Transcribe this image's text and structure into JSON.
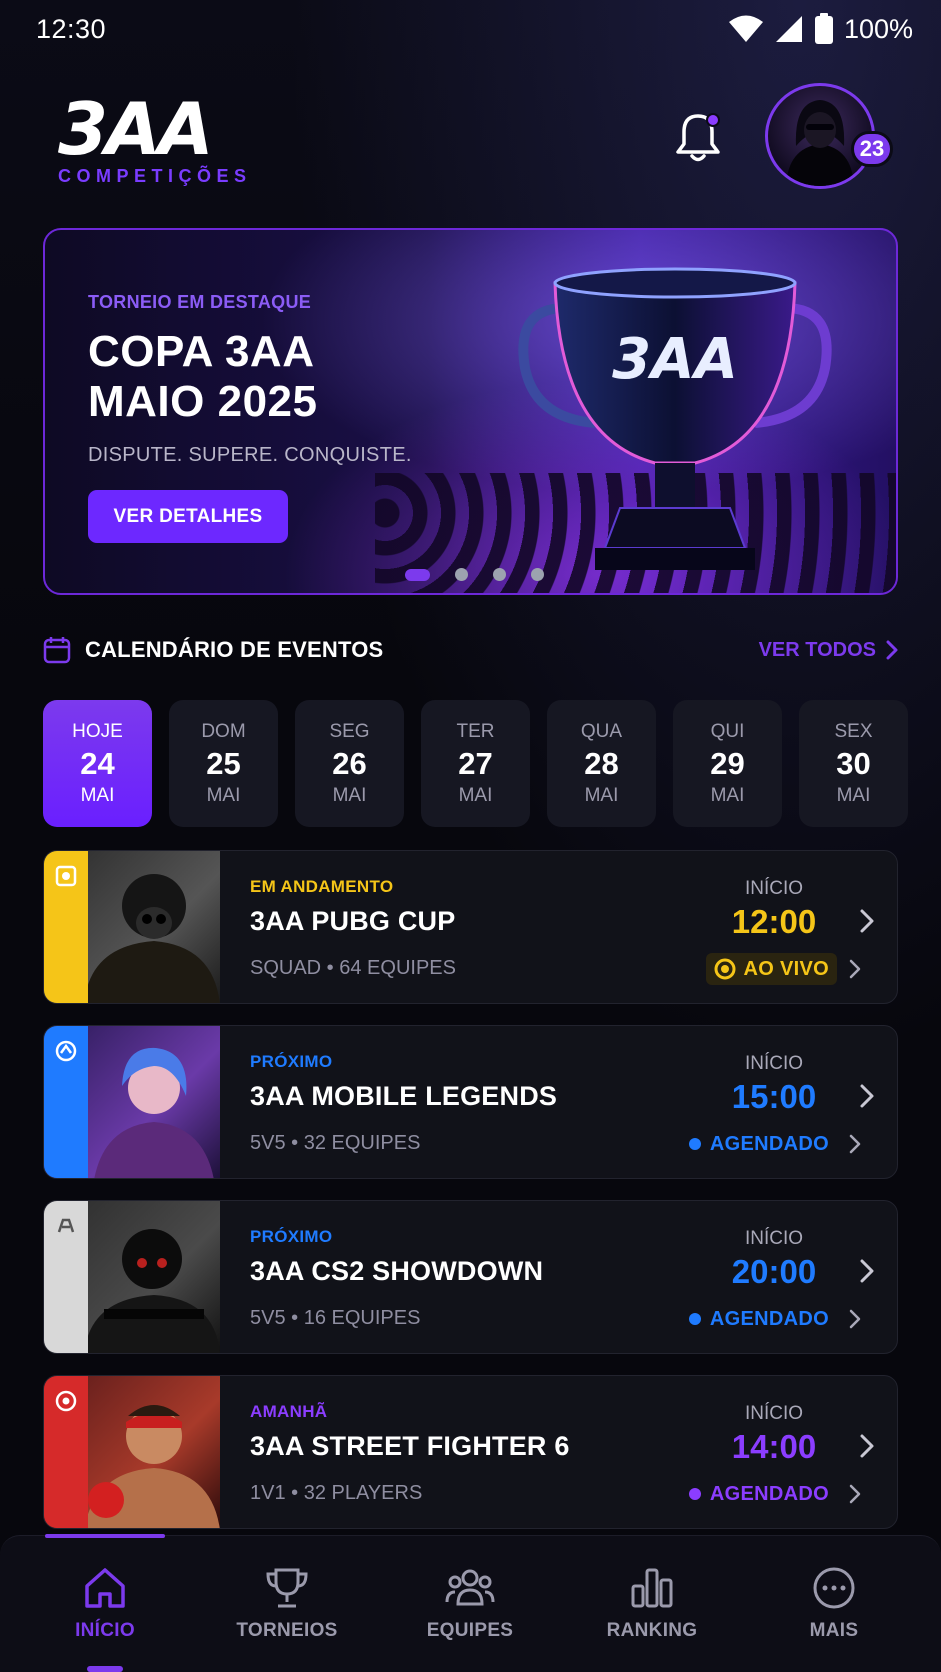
{
  "status_bar": {
    "time": "12:30",
    "battery": "100%"
  },
  "header": {
    "logo_mark": "3AA",
    "logo_sub": "COMPETIÇÕES",
    "avatar_badge": "23"
  },
  "hero": {
    "eyebrow": "TORNEIO EM DESTAQUE",
    "title": "COPA 3AA MAIO 2025",
    "tagline": "DISPUTE. SUPERE. CONQUISTE.",
    "button": "VER DETALHES",
    "trophy_text": "3AA",
    "carousel_pages": 4,
    "carousel_active": 1
  },
  "calendar": {
    "title": "CALENDÁRIO DE EVENTOS",
    "see_all": "VER TODOS",
    "days": [
      {
        "name": "HOJE",
        "date": "24",
        "month": "MAI",
        "active": true
      },
      {
        "name": "DOM",
        "date": "25",
        "month": "MAI"
      },
      {
        "name": "SEG",
        "date": "26",
        "month": "MAI"
      },
      {
        "name": "TER",
        "date": "27",
        "month": "MAI"
      },
      {
        "name": "QUA",
        "date": "28",
        "month": "MAI"
      },
      {
        "name": "QUI",
        "date": "29",
        "month": "MAI"
      },
      {
        "name": "SEX",
        "date": "30",
        "month": "MAI"
      }
    ]
  },
  "events": [
    {
      "status": "EM ANDAMENTO",
      "name": "3AA PUBG CUP",
      "meta": "SQUAD • 64 EQUIPES",
      "start_label": "INÍCIO",
      "time": "12:00",
      "badge": "AO VIVO",
      "accent": "#f5c518"
    },
    {
      "status": "PRÓXIMO",
      "name": "3AA MOBILE LEGENDS",
      "meta": "5V5 • 32 EQUIPES",
      "start_label": "INÍCIO",
      "time": "15:00",
      "badge": "AGENDADO",
      "accent": "#1f7bff"
    },
    {
      "status": "PRÓXIMO",
      "name": "3AA CS2 SHOWDOWN",
      "meta": "5V5 • 16 EQUIPES",
      "start_label": "INÍCIO",
      "time": "20:00",
      "badge": "AGENDADO",
      "accent": "#1f7bff"
    },
    {
      "status": "AMANHÃ",
      "name": "3AA STREET FIGHTER 6",
      "meta": "1V1 • 32 PLAYERS",
      "start_label": "INÍCIO",
      "time": "14:00",
      "badge": "AGENDADO",
      "accent": "#8b3dff"
    }
  ],
  "nav": [
    {
      "label": "INÍCIO",
      "icon": "home-icon",
      "active": true
    },
    {
      "label": "TORNEIOS",
      "icon": "trophy-icon"
    },
    {
      "label": "EQUIPES",
      "icon": "team-icon"
    },
    {
      "label": "RANKING",
      "icon": "bar-chart-icon"
    },
    {
      "label": "MAIS",
      "icon": "more-icon"
    }
  ],
  "colors": {
    "accent": "#7c3aed",
    "live": "#f5c518",
    "scheduled": "#1f7bff",
    "tomorrow": "#8b3dff"
  }
}
